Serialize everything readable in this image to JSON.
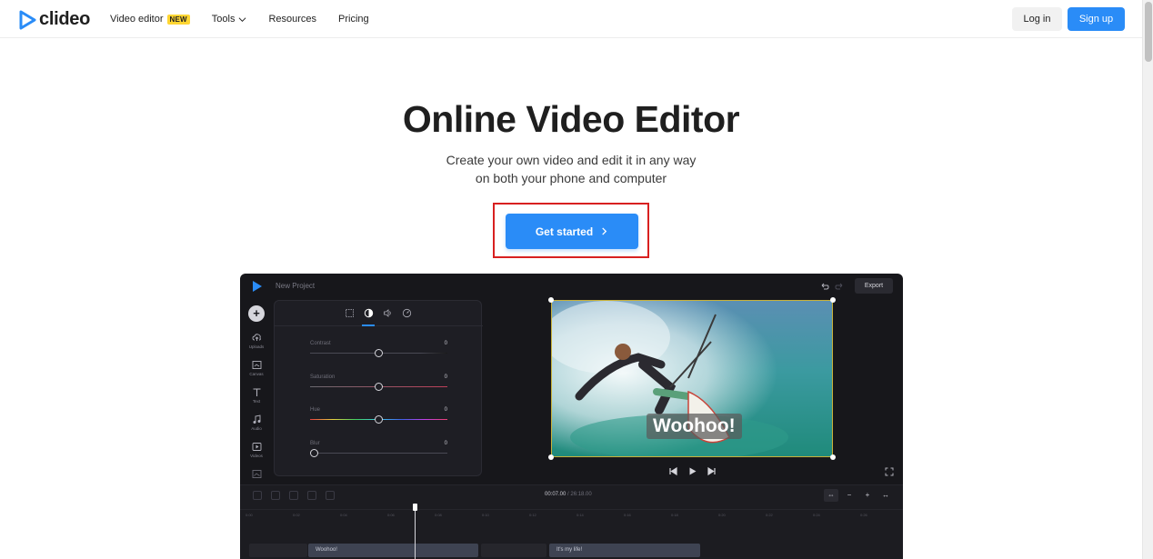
{
  "brand": {
    "name": "clideo",
    "accent": "#2a8cf7"
  },
  "nav": {
    "items": [
      {
        "label": "Video editor",
        "badge": "NEW"
      },
      {
        "label": "Tools",
        "has_dropdown": true
      },
      {
        "label": "Resources"
      },
      {
        "label": "Pricing"
      }
    ]
  },
  "auth": {
    "login_label": "Log in",
    "signup_label": "Sign up"
  },
  "hero": {
    "title": "Online Video Editor",
    "subtitle_line1": "Create your own video and edit it in any way",
    "subtitle_line2": "on both your phone and computer",
    "cta_label": "Get started"
  },
  "editor": {
    "project_name": "New Project",
    "export_label": "Export",
    "sidebar": [
      "Uploads",
      "Canvas",
      "Text",
      "Audio",
      "Videos"
    ],
    "adjustments": [
      {
        "label": "Contrast",
        "value": "0",
        "level": 0.5
      },
      {
        "label": "Saturation",
        "value": "0",
        "level": 0.5
      },
      {
        "label": "Hue",
        "value": "0",
        "level": 0.5
      },
      {
        "label": "Blur",
        "value": "0",
        "level": 0.0
      }
    ],
    "caption": "Woohoo!",
    "current_time": "00:07.00",
    "total_time": "26:18.00",
    "clips": [
      "Woohoo!",
      "It's my life!"
    ]
  }
}
